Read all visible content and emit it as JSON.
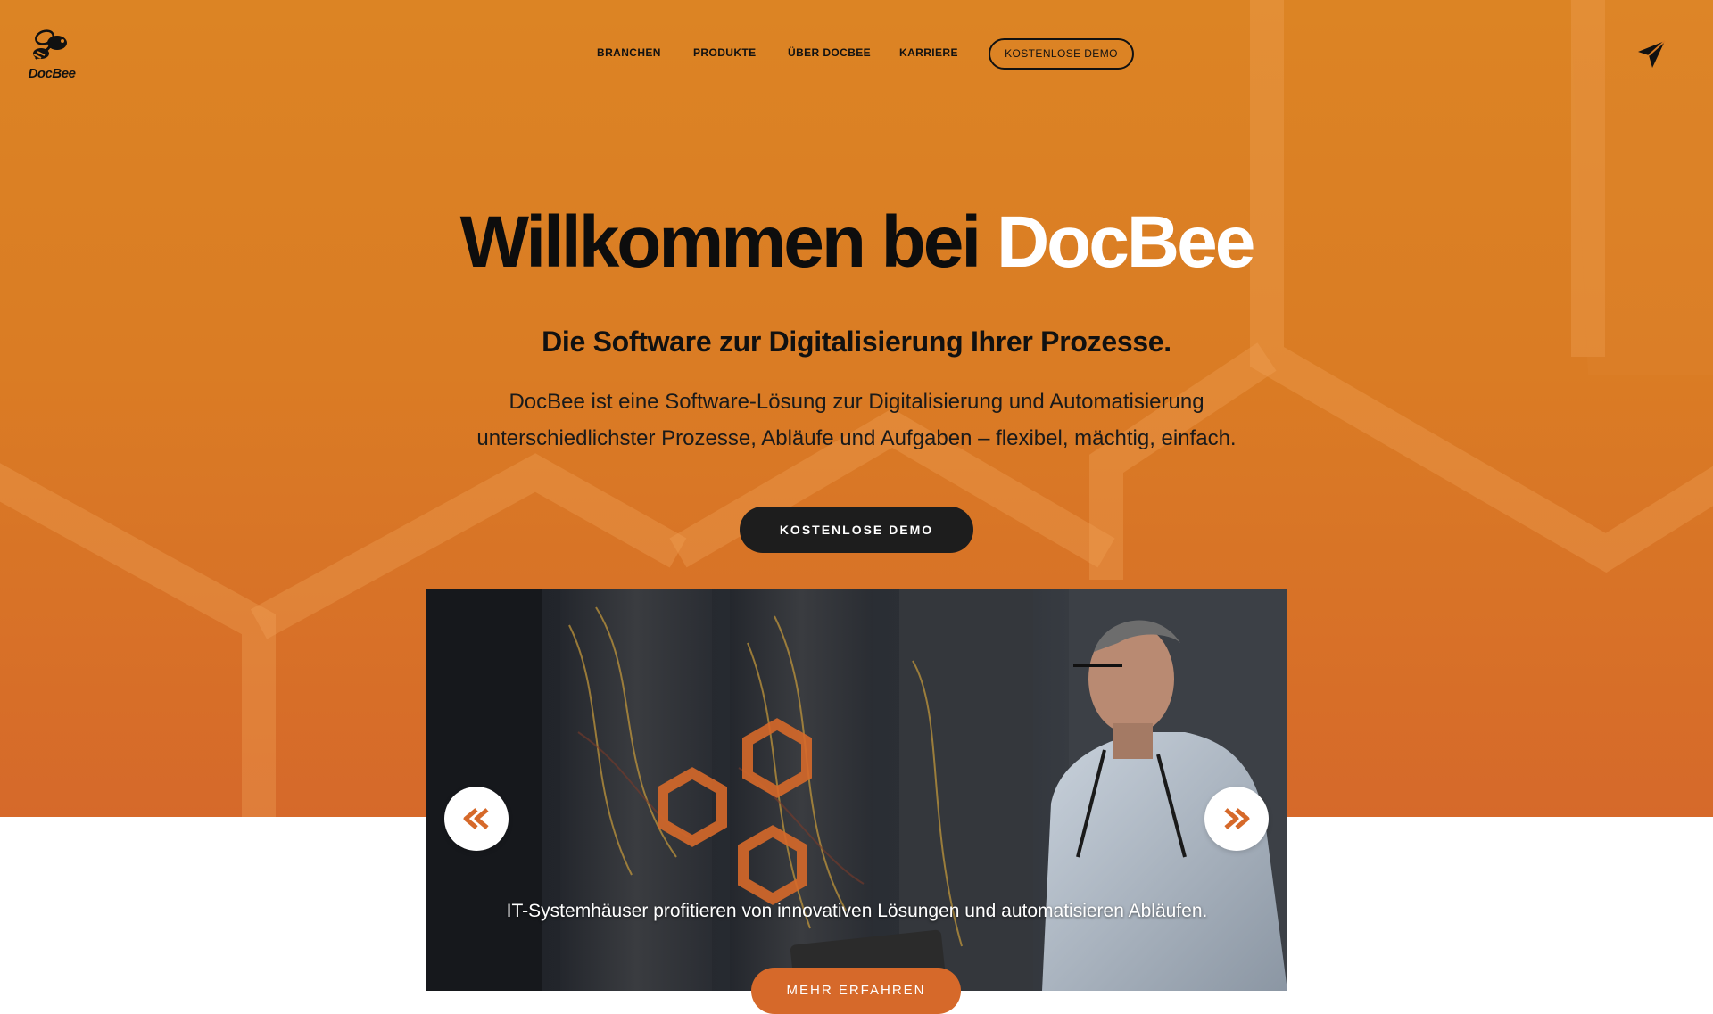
{
  "brand": {
    "logo_text": "DocBee"
  },
  "nav": {
    "items": [
      {
        "label": "BRANCHEN"
      },
      {
        "label": "PRODUKTE"
      },
      {
        "label": "ÜBER DOCBEE"
      },
      {
        "label": "KARRIERE"
      }
    ],
    "cta_label": "KOSTENLOSE DEMO",
    "contact_icon": "paper-plane-icon"
  },
  "hero": {
    "headline_prefix": "Willkommen bei",
    "headline_brand": "DocBee",
    "subheadline": "Die Software zur Digitalisierung Ihrer Prozesse.",
    "intro": "DocBee ist eine Software-Lösung zur Digitalisierung und Automatisierung unterschiedlichster Prozesse, Abläufe und Aufgaben – flexibel, mächtig, einfach.",
    "demo_button": "KOSTENLOSE DEMO"
  },
  "slider": {
    "caption": "IT-Systemhäuser profitieren von innovativen Lösungen und automatisieren Abläufen.",
    "more_button": "MEHR ERFAHREN",
    "prev_icon": "chevron-left-icon",
    "next_icon": "chevron-right-icon"
  },
  "colors": {
    "hero_orange": "#da7c24",
    "accent_orange": "#d6692a",
    "dark": "#1d1d1d",
    "white": "#ffffff"
  }
}
